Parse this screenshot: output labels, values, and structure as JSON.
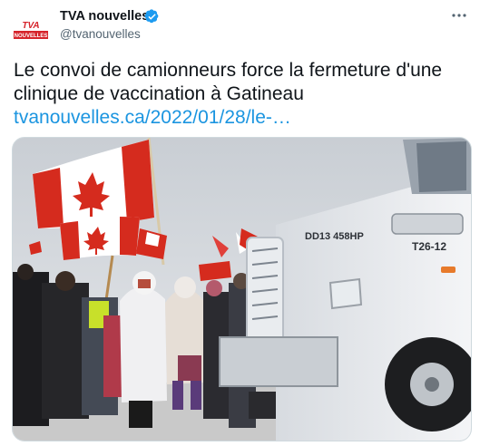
{
  "account": {
    "display_name": "TVA nouvelles",
    "handle": "@tvanouvelles",
    "verified": true,
    "avatar_logo_top": "TVA",
    "avatar_logo_bottom": "NOUVELLES"
  },
  "tweet": {
    "text_line1": "Le convoi de camionneurs force la fermeture d'une",
    "text_line2": "clinique de vaccination à Gatineau",
    "link": "tvanouvelles.ca/2022/01/28/le-…"
  },
  "media": {
    "truck_plate": "DD13 458HP",
    "truck_number": "T26-12"
  },
  "icons": {
    "verified": "verified-badge-icon",
    "more": "more-options-icon"
  },
  "colors": {
    "link": "#1b95e0",
    "verified": "#1d9bf0",
    "brand_red": "#d6232a",
    "flag_red": "#d52b1e",
    "secondary_text": "#536471"
  }
}
